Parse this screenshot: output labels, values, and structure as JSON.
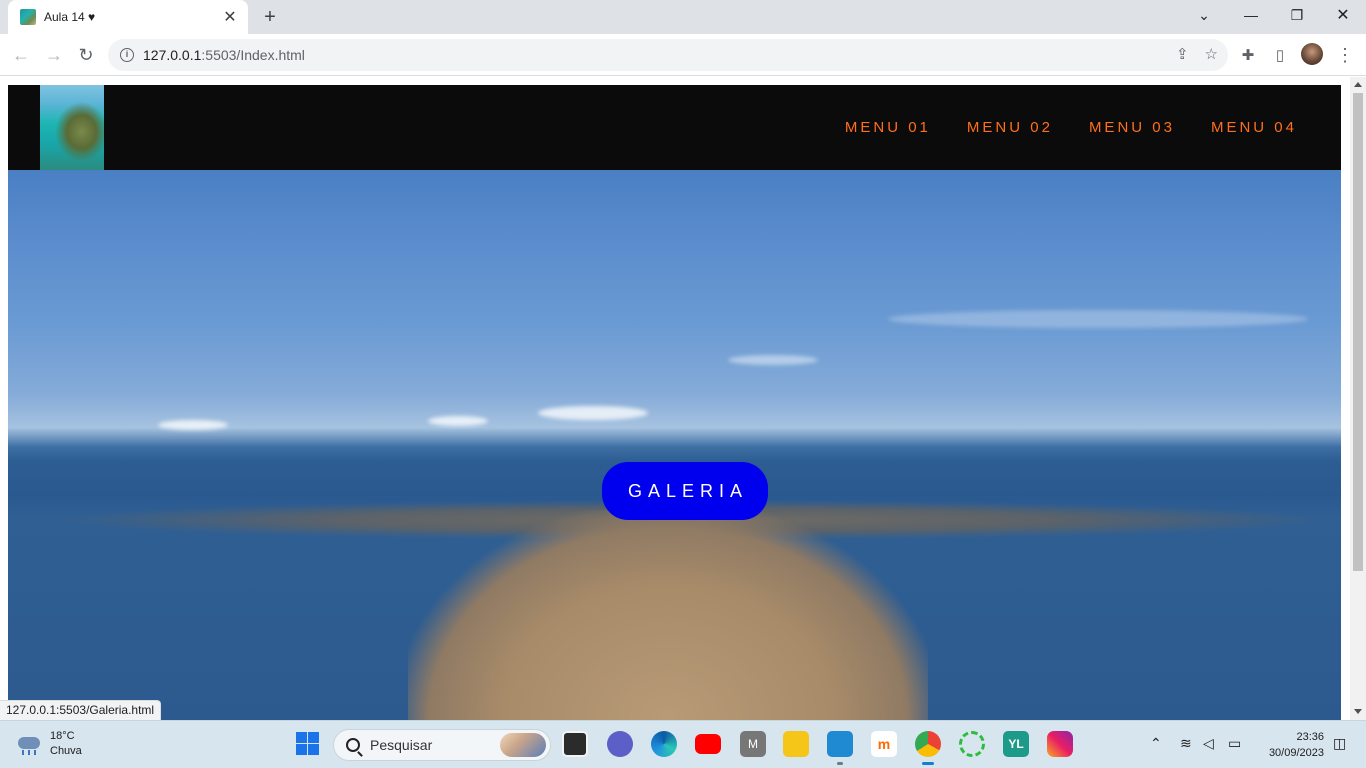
{
  "browser": {
    "tab": {
      "title": "Aula 14 ♥"
    },
    "url": {
      "host": "127.0.0.1",
      "rest": ":5503/Index.html"
    },
    "status_url": "127.0.0.1:5503/Galeria.html"
  },
  "page": {
    "menu": [
      "MENU 01",
      "MENU 02",
      "MENU 03",
      "MENU 04"
    ],
    "hero_button": "GALERIA",
    "colors": {
      "header_bg": "#0b0b0b",
      "menu_text": "#ff6f1a",
      "button_bg": "#0000ee"
    }
  },
  "taskbar": {
    "weather": {
      "temp": "18°C",
      "condition": "Chuva"
    },
    "search_label": "Pesquisar",
    "time": "23:36",
    "date": "30/09/2023"
  }
}
